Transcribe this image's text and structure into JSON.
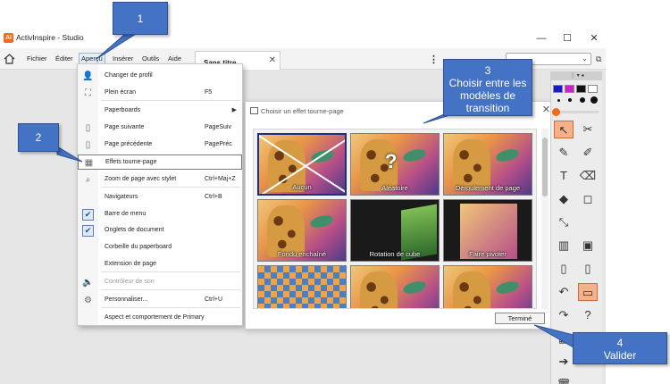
{
  "window": {
    "title": "ActivInspire - Studio",
    "logo": "AI",
    "minimize_icon": "—",
    "maximize_icon": "☐",
    "close_icon": "✕"
  },
  "menubar": {
    "items": [
      "Fichier",
      "Éditer",
      "Aperçu",
      "Insérer",
      "Outils",
      "Aide"
    ],
    "active": "Aperçu"
  },
  "document_tab": {
    "label": "Sans titre",
    "close_icon": "✕"
  },
  "more_icon": "⋮",
  "dropdown": {
    "items": [
      {
        "label": "Changer de profil",
        "shortcut": "",
        "icon": "profile-icon",
        "glyph": "👤"
      },
      {
        "label": "Plein écran",
        "shortcut": "F5",
        "icon": "fullscreen-icon",
        "glyph": "⛶"
      },
      {
        "label": "Paperboards",
        "shortcut": "",
        "icon": "",
        "glyph": "",
        "submenu": "▶"
      },
      {
        "label": "Page suivante",
        "shortcut": "PageSuiv",
        "icon": "next-page-icon",
        "glyph": "▯"
      },
      {
        "label": "Page précédente",
        "shortcut": "PagePréc",
        "icon": "previous-page-icon",
        "glyph": "▯"
      },
      {
        "label": "Effets tourne-page",
        "shortcut": "",
        "icon": "page-turn-icon",
        "glyph": "▦"
      },
      {
        "label": "Zoom de page avec stylet",
        "shortcut": "Ctrl+Maj+Z",
        "icon": "zoom-icon",
        "glyph": "⌕"
      },
      {
        "label": "Navigateurs",
        "shortcut": "Ctrl+B",
        "icon": "",
        "glyph": ""
      },
      {
        "label": "Barre de menu",
        "shortcut": "",
        "icon": "check-icon",
        "glyph": "✔"
      },
      {
        "label": "Onglets de document",
        "shortcut": "",
        "icon": "check-icon",
        "glyph": "✔"
      },
      {
        "label": "Corbeille du paperboard",
        "shortcut": "",
        "icon": "",
        "glyph": ""
      },
      {
        "label": "Extension de page",
        "shortcut": "",
        "icon": "",
        "glyph": ""
      },
      {
        "label": "Contrôleur de son",
        "shortcut": "",
        "icon": "sound-icon",
        "glyph": "🔈"
      },
      {
        "label": "Personnaliser...",
        "shortcut": "Ctrl+U",
        "icon": "customize-icon",
        "glyph": "⚙"
      },
      {
        "label": "Aspect et comportement de Primary",
        "shortcut": "",
        "icon": "",
        "glyph": ""
      }
    ]
  },
  "dialog": {
    "title": "Choisir un effet tourne-page",
    "close_icon": "✕",
    "effects": [
      "Aucun",
      "Aléatoire",
      "Déroulement de page",
      "Fondu enchaîné",
      "Rotation de cube",
      "Faire pivoter",
      "",
      "",
      ""
    ],
    "random_mark": "?",
    "done_button": "Terminé"
  },
  "toolbox": {
    "header": "⋮ ▾ ◂",
    "colors": [
      "#1a1acc",
      "#cc22cc",
      "#111111",
      "#ffffff",
      "#ffffff",
      "#ffffff"
    ],
    "tools": [
      {
        "name": "select-tool-icon",
        "glyph": "↖"
      },
      {
        "name": "tools-icon",
        "glyph": "✂"
      },
      {
        "name": "pen-icon",
        "glyph": "✎"
      },
      {
        "name": "highlighter-icon",
        "glyph": "✐"
      },
      {
        "name": "text-icon",
        "glyph": "T"
      },
      {
        "name": "eraser-icon",
        "glyph": "⌫"
      },
      {
        "name": "fill-icon",
        "glyph": "◆"
      },
      {
        "name": "shapes-icon",
        "glyph": "◻"
      },
      {
        "name": "connector-icon",
        "glyph": "⤡"
      },
      {
        "name": "blank-icon",
        "glyph": ""
      },
      {
        "name": "pages-icon",
        "glyph": "▥"
      },
      {
        "name": "camera-icon",
        "glyph": "▣"
      },
      {
        "name": "clear-icon",
        "glyph": "▯"
      },
      {
        "name": "reset-page-icon",
        "glyph": "▯"
      },
      {
        "name": "undo-icon",
        "glyph": "↶"
      },
      {
        "name": "page-turn-tool-icon",
        "glyph": "▭"
      },
      {
        "name": "redo-icon",
        "glyph": "↷"
      },
      {
        "name": "question-icon",
        "glyph": "?"
      },
      {
        "name": "grid-icon",
        "glyph": "▦"
      },
      {
        "name": "blank-icon",
        "glyph": ""
      },
      {
        "name": "forward-icon",
        "glyph": "➔"
      },
      {
        "name": "blank-icon",
        "glyph": ""
      },
      {
        "name": "trash-icon",
        "glyph": "🗑"
      },
      {
        "name": "blank-icon",
        "glyph": ""
      }
    ]
  },
  "callouts": {
    "c1": {
      "number": "1",
      "text": ""
    },
    "c2": {
      "number": "2",
      "text": ""
    },
    "c3": {
      "number": "3",
      "text": "Choisir entre les modèles de transition"
    },
    "c4": {
      "number": "4",
      "text": "Valider"
    }
  },
  "colors": {
    "callout": "#4472c4",
    "accent": "#f26a1b",
    "selection": "#1f2f7a"
  }
}
